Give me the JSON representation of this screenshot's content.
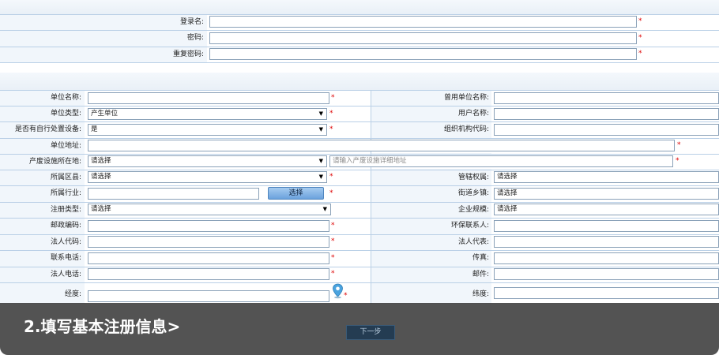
{
  "account": {
    "login_label": "登录名:",
    "password_label": "密码:",
    "repeat_password_label": "重复密码:"
  },
  "required_mark": "*",
  "unit": {
    "name_label": "单位名称:",
    "former_name_label": "曾用单位名称:",
    "type_label": "单位类型:",
    "type_value": "产生单位",
    "username_label": "用户名称:",
    "self_disposal_label": "是否有自行处置设备:",
    "self_disposal_value": "是",
    "org_code_label": "组织机构代码:",
    "address_label": "单位地址:",
    "facility_location_label": "产废设施所在地:",
    "facility_location_value": "请选择",
    "facility_address_placeholder": "请输入产废设施详细地址",
    "county_label": "所属区县:",
    "county_value": "请选择",
    "jurisdiction_label": "管辖权属:",
    "jurisdiction_value": "请选择",
    "industry_label": "所属行业:",
    "choose_button": "选择",
    "town_label": "街道乡镇:",
    "town_value": "请选择",
    "reg_type_label": "注册类型:",
    "reg_type_value": "请选择",
    "scale_label": "企业规模:",
    "scale_value": "请选择",
    "postcode_label": "邮政编码:",
    "env_contact_label": "环保联系人:",
    "legal_code_label": "法人代码:",
    "legal_rep_label": "法人代表:",
    "phone_label": "联系电话:",
    "fax_label": "传真:",
    "legal_phone_label": "法人电话:",
    "email_label": "邮件:",
    "longitude_label": "经度:",
    "latitude_label": "纬度:"
  },
  "next_button": "下一步",
  "caption": "2.填写基本注册信息>",
  "icons": {
    "arrow": "▼",
    "map_pin": "map-pin-icon"
  },
  "colors": {
    "required": "#d00000",
    "overlay": "#2e2e2e",
    "pin": "#4aa3df"
  }
}
